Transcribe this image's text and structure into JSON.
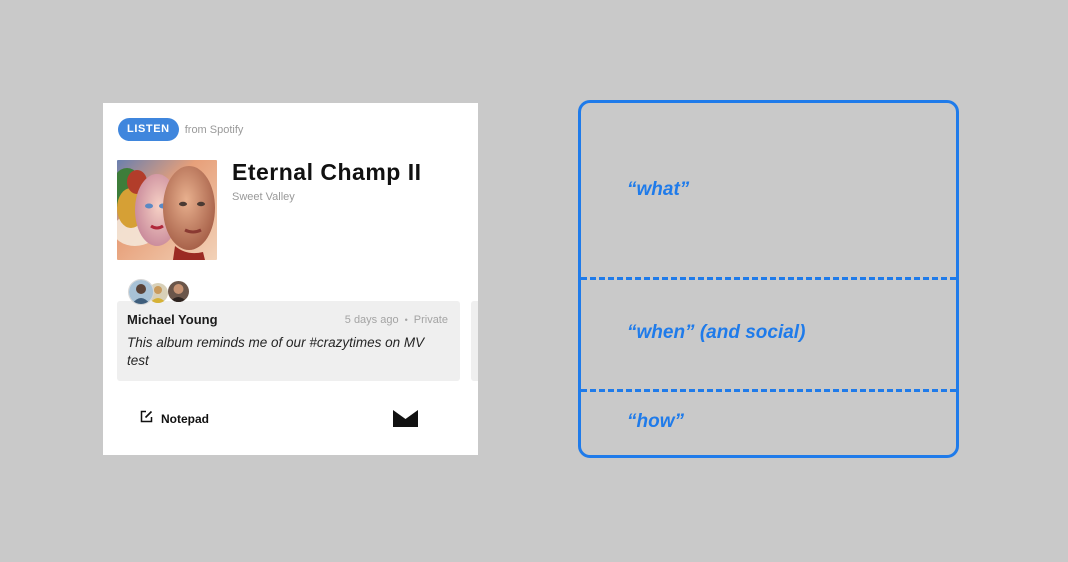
{
  "card": {
    "badge": "LISTEN",
    "source": "from Spotify",
    "title": "Eternal Champ II",
    "artist": "Sweet Valley",
    "comment": {
      "author": "Michael Young",
      "time": "5 days ago",
      "separator": "•",
      "visibility": "Private",
      "text": "This album reminds me of our #crazytimes on MV test"
    },
    "footer": {
      "notepad_label": "Notepad",
      "notepad_icon": "edit-icon",
      "brand_icon": "m-logo-icon"
    }
  },
  "diagram": {
    "color": "#1f7bea",
    "sections": [
      {
        "label": "“what”"
      },
      {
        "label": "“when” (and social)"
      },
      {
        "label": "“how”"
      }
    ]
  },
  "colors": {
    "background": "#c9c9c9",
    "badge": "#3f86dd",
    "comment_bg": "#efefef"
  }
}
